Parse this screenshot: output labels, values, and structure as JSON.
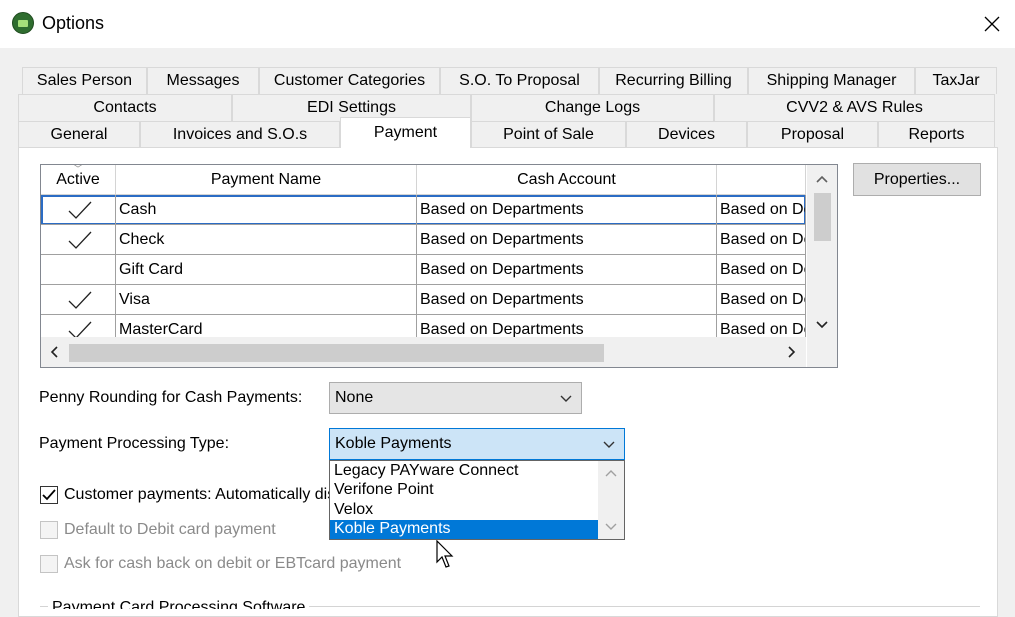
{
  "window": {
    "title": "Options"
  },
  "tabs": {
    "row1": [
      "Sales Person",
      "Messages",
      "Customer Categories",
      "S.O. To Proposal",
      "Recurring Billing",
      "Shipping Manager",
      "TaxJar"
    ],
    "row2": [
      "Contacts",
      "EDI Settings",
      "Change Logs",
      "CVV2 & AVS Rules"
    ],
    "row3": [
      "General",
      "Invoices and S.O.s",
      "Payment",
      "Point of Sale",
      "Devices",
      "Proposal",
      "Reports"
    ],
    "active": "Payment"
  },
  "grid": {
    "columns": [
      "Active",
      "Payment Name",
      "Cash Account",
      ""
    ],
    "rows": [
      {
        "active": true,
        "name": "Cash",
        "cash_account": "Based on Departments",
        "col4": "Based on De"
      },
      {
        "active": true,
        "name": "Check",
        "cash_account": "Based on Departments",
        "col4": "Based on De"
      },
      {
        "active": false,
        "name": "Gift Card",
        "cash_account": "Based on Departments",
        "col4": "Based on De"
      },
      {
        "active": true,
        "name": "Visa",
        "cash_account": "Based on Departments",
        "col4": "Based on De"
      },
      {
        "active": true,
        "name": "MasterCard",
        "cash_account": "Based on Departments",
        "col4": "Based on De"
      }
    ],
    "selected_row": 0
  },
  "properties_button": "Properties...",
  "penny_rounding": {
    "label": "Penny Rounding for Cash Payments:",
    "value": "None"
  },
  "processing_type": {
    "label": "Payment Processing Type:",
    "value": "Koble Payments",
    "options": [
      "Legacy PAYware Connect",
      "Verifone Point",
      "Velox",
      "Koble Payments"
    ],
    "highlighted": "Koble Payments"
  },
  "checkboxes": [
    {
      "label": "Customer payments: Automatically dis",
      "checked": true,
      "enabled": true
    },
    {
      "label": "Default to Debit card payment",
      "checked": false,
      "enabled": false
    },
    {
      "label": "Ask for cash back on debit or EBTcard payment",
      "checked": false,
      "enabled": false
    }
  ],
  "group_title": "Payment Card Processing Software",
  "colors": {
    "accent": "#0078d7",
    "selection_outline": "#2b6cc4",
    "disabled_text": "#8a8a8a"
  },
  "icons": {
    "close": "close-icon",
    "app": "app-icon",
    "check": "check-mark-icon",
    "chevron": "chevron-down-icon"
  }
}
